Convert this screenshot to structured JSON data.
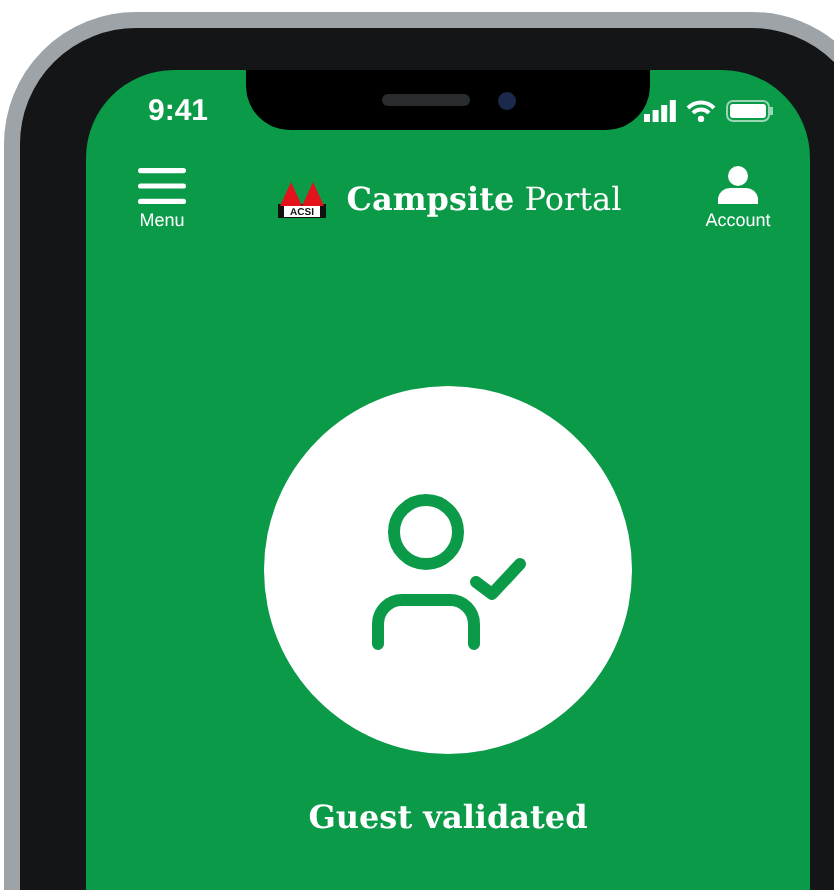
{
  "status_bar": {
    "time": "9:41"
  },
  "header": {
    "menu_label": "Menu",
    "logo_text": "ACSI",
    "brand": "**Campsite** Portal",
    "account_label": "Account"
  },
  "status_message": "Guest validated"
}
